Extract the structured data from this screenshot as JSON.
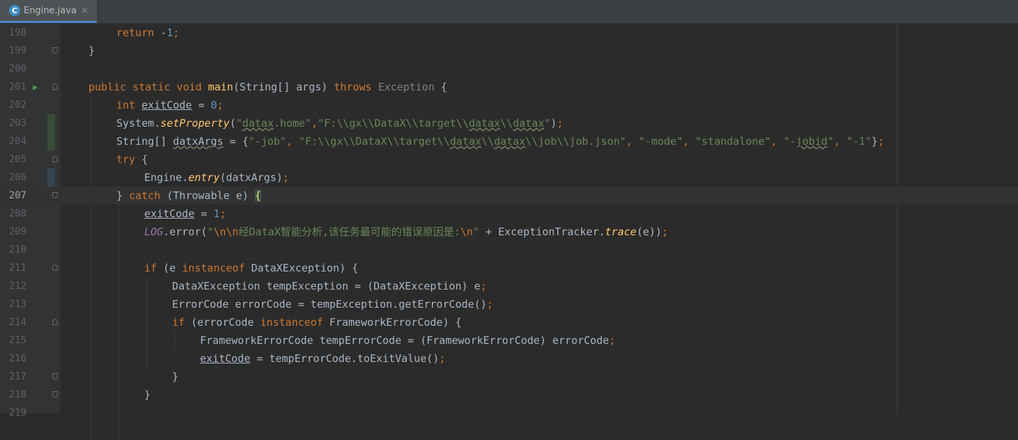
{
  "tab": {
    "icon": "C",
    "title": "Engine.java",
    "close": "×"
  },
  "lines": [
    {
      "n": "198",
      "code": [
        [
          "k",
          "return "
        ],
        [
          "p",
          "-"
        ],
        [
          "n",
          "1"
        ],
        [
          "k",
          ";"
        ]
      ]
    },
    {
      "n": "199",
      "code": [
        [
          "p",
          "}"
        ]
      ]
    },
    {
      "n": "200",
      "code": []
    },
    {
      "n": "201",
      "code": [
        [
          "k",
          "public static void "
        ],
        [
          "f",
          "main"
        ],
        [
          "p",
          "(String[] args) "
        ],
        [
          "k",
          "throws "
        ],
        [
          "c",
          "Exception "
        ],
        [
          "p",
          "{"
        ]
      ]
    },
    {
      "n": "202",
      "code": [
        [
          "k",
          "int "
        ],
        [
          "u",
          "exitCode"
        ],
        [
          "p",
          " = "
        ],
        [
          "n",
          "0"
        ],
        [
          "k",
          ";"
        ]
      ]
    },
    {
      "n": "203",
      "code": [
        [
          "p",
          "System."
        ],
        [
          "i",
          "setProperty"
        ],
        [
          "p",
          "("
        ],
        [
          "s",
          "\""
        ],
        [
          "sw",
          "datax"
        ],
        [
          "s",
          ".home\""
        ],
        [
          "k",
          ","
        ],
        [
          "s",
          "\"F:\\\\gx\\\\DataX\\\\target\\\\"
        ],
        [
          "sw",
          "datax"
        ],
        [
          "s",
          "\\\\"
        ],
        [
          "sw",
          "datax"
        ],
        [
          "s",
          "\""
        ],
        [
          "p",
          ")"
        ],
        [
          "k",
          ";"
        ]
      ]
    },
    {
      "n": "204",
      "code": [
        [
          "p",
          "String[] "
        ],
        [
          "pw",
          "datxArgs"
        ],
        [
          "p",
          " = {"
        ],
        [
          "s",
          "\"-job\""
        ],
        [
          "k",
          ", "
        ],
        [
          "s",
          "\"F:\\\\gx\\\\DataX\\\\target\\\\"
        ],
        [
          "sw",
          "datax"
        ],
        [
          "s",
          "\\\\"
        ],
        [
          "sw",
          "datax"
        ],
        [
          "s",
          "\\\\job\\\\job.json\""
        ],
        [
          "k",
          ", "
        ],
        [
          "s",
          "\"-mode\""
        ],
        [
          "k",
          ", "
        ],
        [
          "s",
          "\"standalone\""
        ],
        [
          "k",
          ", "
        ],
        [
          "s",
          "\"-"
        ],
        [
          "sw",
          "jobid"
        ],
        [
          "s",
          "\""
        ],
        [
          "k",
          ", "
        ],
        [
          "s",
          "\"-1\""
        ],
        [
          "p",
          "}"
        ],
        [
          "k",
          ";"
        ]
      ]
    },
    {
      "n": "205",
      "code": [
        [
          "k",
          "try "
        ],
        [
          "p",
          "{"
        ]
      ]
    },
    {
      "n": "206",
      "code": [
        [
          "p",
          "Engine."
        ],
        [
          "i",
          "entry"
        ],
        [
          "p",
          "(datxArgs)"
        ],
        [
          "k",
          ";"
        ]
      ]
    },
    {
      "n": "207",
      "code": [
        [
          "p",
          "} "
        ],
        [
          "k",
          "catch "
        ],
        [
          "p",
          "(Throwable e) "
        ],
        [
          "b",
          "{"
        ]
      ]
    },
    {
      "n": "208",
      "code": [
        [
          "u",
          "exitCode"
        ],
        [
          "p",
          " = "
        ],
        [
          "n",
          "1"
        ],
        [
          "k",
          ";"
        ]
      ]
    },
    {
      "n": "209",
      "code": [
        [
          "cn",
          "LOG"
        ],
        [
          "p",
          ".error("
        ],
        [
          "s",
          "\""
        ],
        [
          "k",
          "\\n\\n"
        ],
        [
          "s",
          "经DataX智能分析,该任务最可能的错误原因是:"
        ],
        [
          "k",
          "\\n"
        ],
        [
          "s",
          "\""
        ],
        [
          "p",
          " + ExceptionTracker."
        ],
        [
          "i",
          "trace"
        ],
        [
          "p",
          "(e))"
        ],
        [
          "k",
          ";"
        ]
      ]
    },
    {
      "n": "210",
      "code": []
    },
    {
      "n": "211",
      "code": [
        [
          "k",
          "if "
        ],
        [
          "p",
          "(e "
        ],
        [
          "k",
          "instanceof "
        ],
        [
          "p",
          "DataXException) {"
        ]
      ]
    },
    {
      "n": "212",
      "code": [
        [
          "p",
          "DataXException tempException = (DataXException) e"
        ],
        [
          "k",
          ";"
        ]
      ]
    },
    {
      "n": "213",
      "code": [
        [
          "p",
          "ErrorCode errorCode = tempException.getErrorCode()"
        ],
        [
          "k",
          ";"
        ]
      ]
    },
    {
      "n": "214",
      "code": [
        [
          "k",
          "if "
        ],
        [
          "p",
          "(errorCode "
        ],
        [
          "k",
          "instanceof "
        ],
        [
          "p",
          "FrameworkErrorCode) {"
        ]
      ]
    },
    {
      "n": "215",
      "code": [
        [
          "p",
          "FrameworkErrorCode tempErrorCode = (FrameworkErrorCode) errorCode"
        ],
        [
          "k",
          ";"
        ]
      ]
    },
    {
      "n": "216",
      "code": [
        [
          "u",
          "exitCode"
        ],
        [
          "p",
          " = tempErrorCode.toExitValue()"
        ],
        [
          "k",
          ";"
        ]
      ]
    },
    {
      "n": "217",
      "code": [
        [
          "p",
          "}"
        ]
      ]
    },
    {
      "n": "218",
      "code": [
        [
          "p",
          "}"
        ]
      ]
    },
    {
      "n": "219",
      "code": []
    }
  ],
  "current_line": "207",
  "colors": {
    "background": "#2b2b2b",
    "keyword": "#cc7832",
    "string": "#6a8759",
    "number": "#6897bb",
    "method": "#ffc66d",
    "text": "#a9b7c6",
    "constant": "#9876aa"
  }
}
